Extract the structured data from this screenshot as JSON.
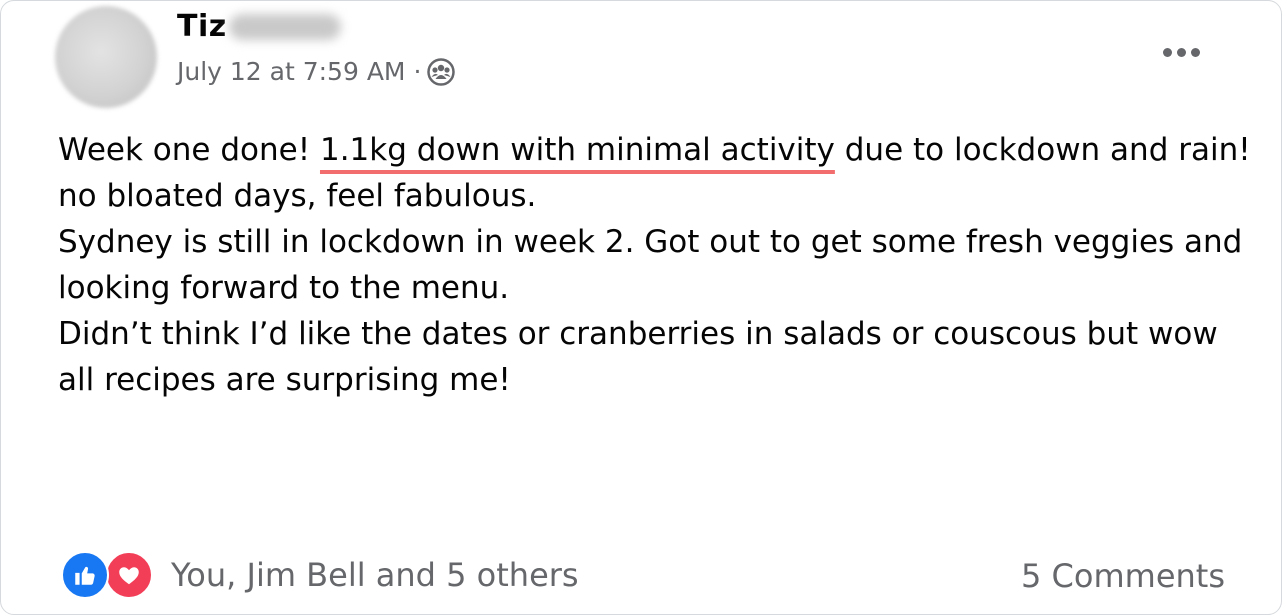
{
  "post": {
    "author": "Tiz",
    "timestamp": "July 12 at 7:59 AM",
    "separator": "·",
    "audience_icon": "group-icon",
    "more_icon": "more-options-icon",
    "text": {
      "line1_before": "Week one done! ",
      "line1_highlight": "1.1kg down with minimal activity",
      "line1_after": " due to lockdown and rain! no bloated days, feel fabulous.",
      "line2": "Sydney is still in lockdown in week 2. Got out to get some fresh veggies and looking forward to the menu.",
      "line3": "Didn’t think I’d like the dates or cranberries in salads or couscous but wow all recipes are surprising me!"
    },
    "highlight_color": "#f26d6d"
  },
  "footer": {
    "reactions_text": "You, Jim Bell and 5 others",
    "comments_text": "5 Comments",
    "reaction_icons": [
      "like-icon",
      "love-icon"
    ],
    "like_color": "#1877f2",
    "love_color": "#f33e58"
  }
}
